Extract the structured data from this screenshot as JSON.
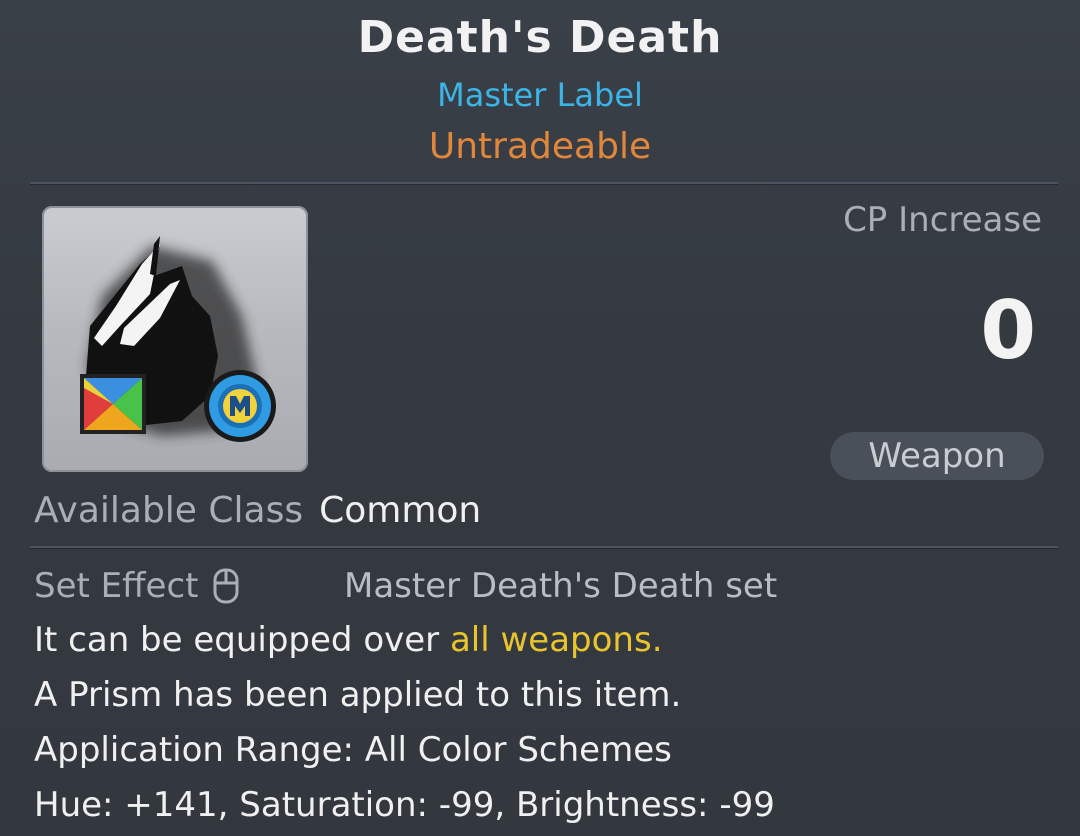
{
  "item": {
    "name": "Death's Death",
    "label": "Master Label",
    "tradeable": "Untradeable",
    "icon": "black-cape-weapon-icon"
  },
  "cp": {
    "label": "CP Increase",
    "value": "0"
  },
  "category": "Weapon",
  "available_class": {
    "label": "Available Class",
    "value": "Common"
  },
  "set_effect": {
    "label": "Set Effect",
    "value": "Master Death's Death set"
  },
  "description": {
    "line1_prefix": "It can be equipped over ",
    "line1_highlight": "all weapons.",
    "line2": "A Prism has been applied to this item.",
    "line3": "Application Range: All Color Schemes",
    "line4": "Hue: +141, Saturation: -99, Brightness: -99"
  },
  "colors": {
    "background": "#353a41",
    "label_blue": "#3cb4e6",
    "untradeable_orange": "#e0873c",
    "highlight_yellow": "#e9c42c",
    "muted_text": "#a9afb6"
  }
}
